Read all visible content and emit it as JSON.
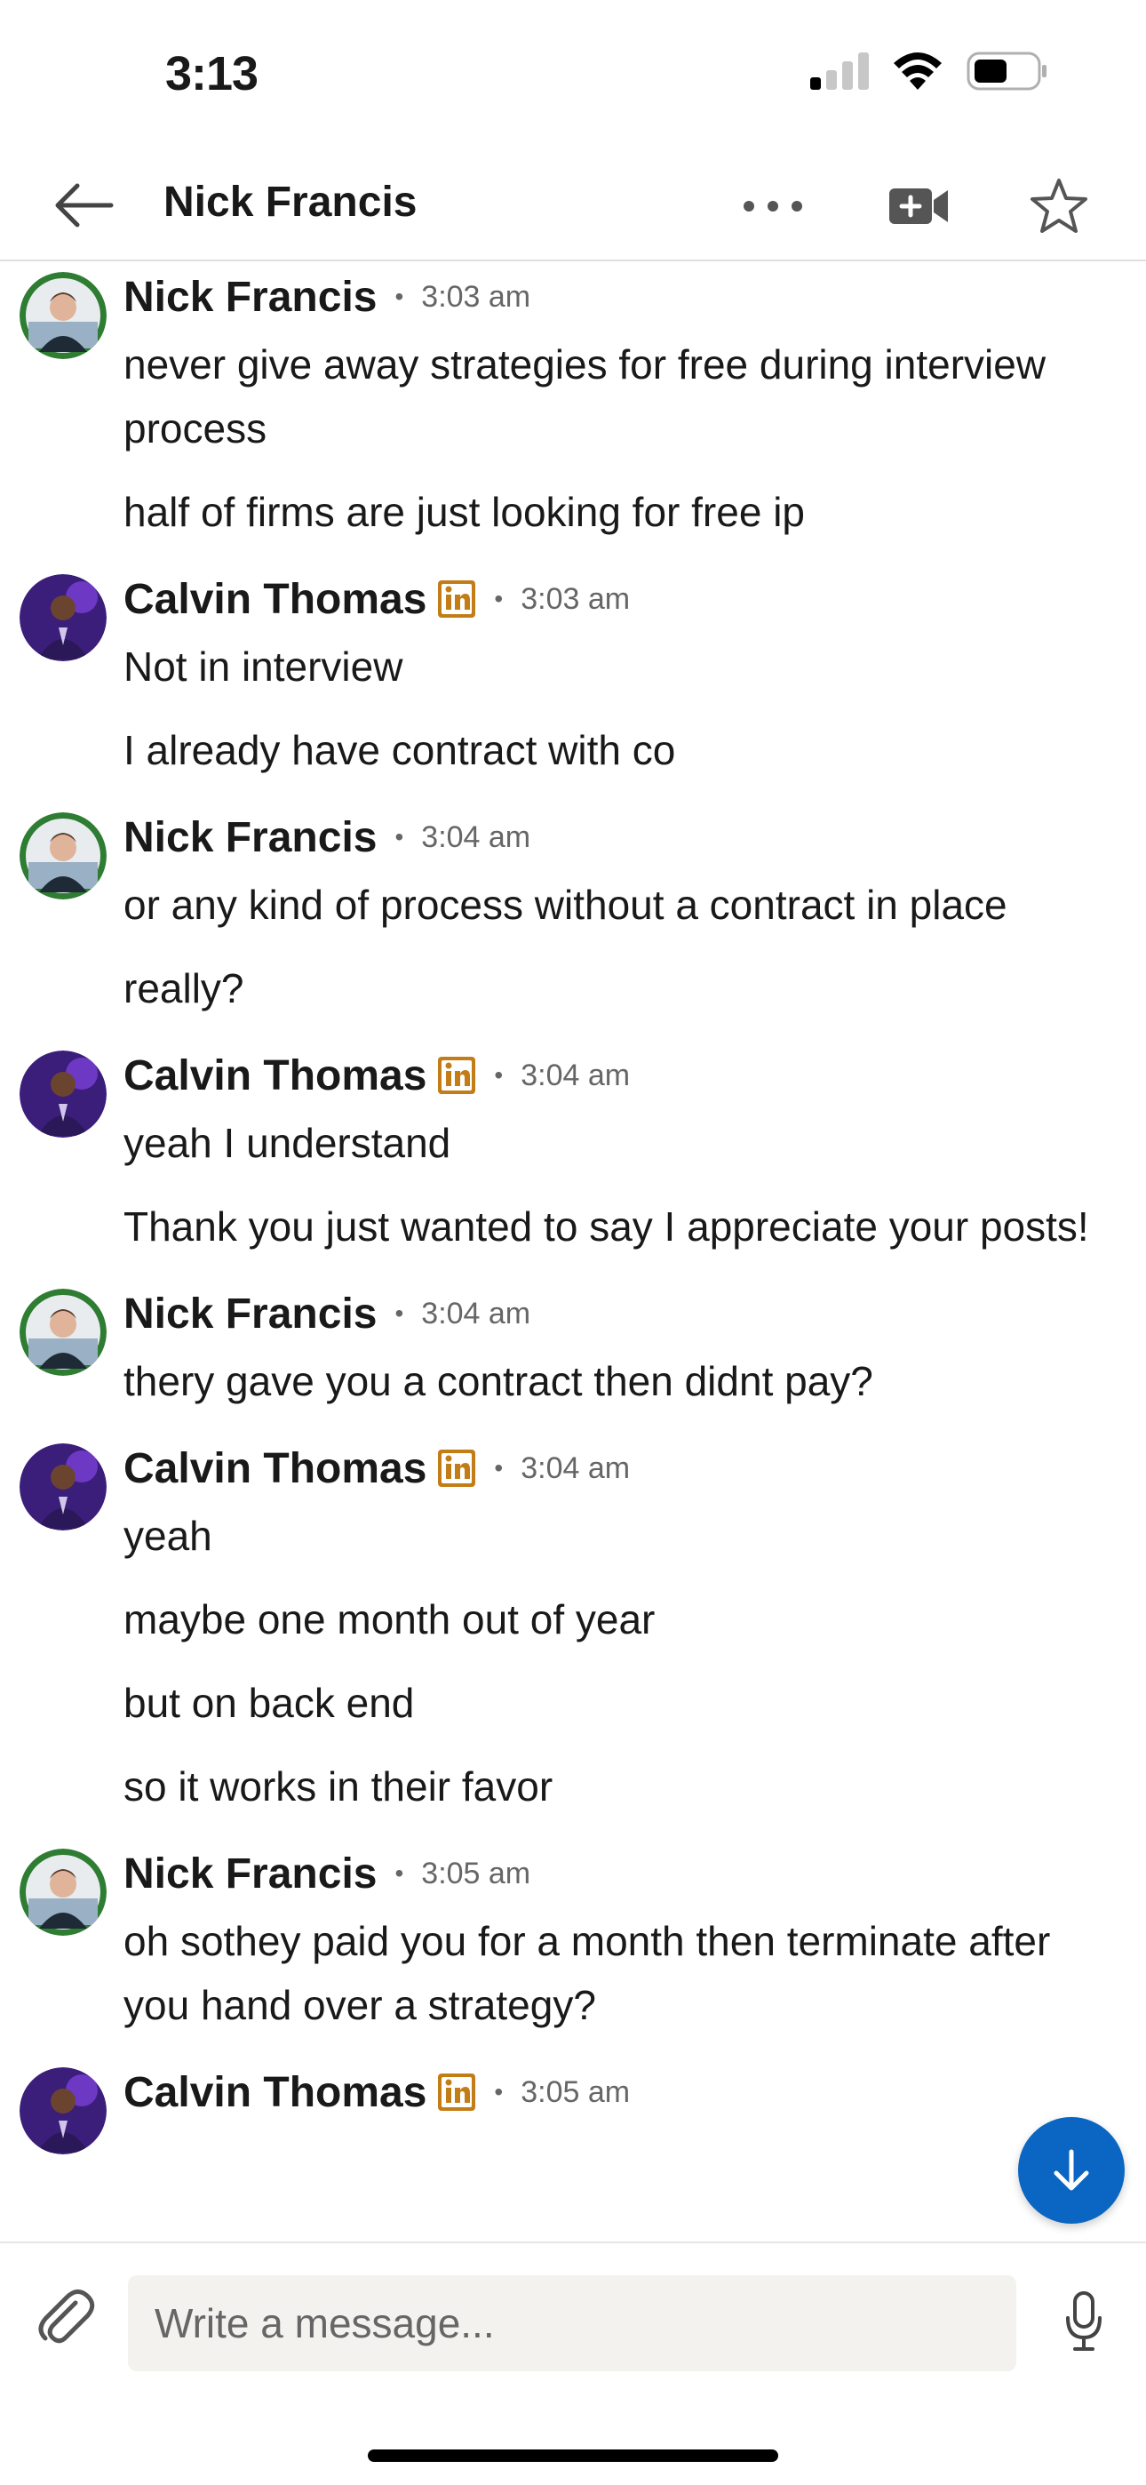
{
  "status_bar": {
    "time": "3:13"
  },
  "header": {
    "title": "Nick Francis"
  },
  "colors": {
    "accent": "#0a66c2",
    "linkedin_badge": "#c37d16"
  },
  "messages": [
    {
      "sender": "Nick Francis",
      "time": "3:03 am",
      "linkedin": false,
      "texts": [
        "never give away strategies for free during interview process",
        "half of firms are just looking for free ip"
      ]
    },
    {
      "sender": "Calvin Thomas",
      "time": "3:03 am",
      "linkedin": true,
      "texts": [
        "Not in interview",
        "I already have contract with co"
      ]
    },
    {
      "sender": "Nick Francis",
      "time": "3:04 am",
      "linkedin": false,
      "texts": [
        "or any kind of process without a contract in place",
        "really?"
      ]
    },
    {
      "sender": "Calvin Thomas",
      "time": "3:04 am",
      "linkedin": true,
      "texts": [
        "yeah I understand",
        "Thank you just wanted to say I appreciate your posts!"
      ]
    },
    {
      "sender": "Nick Francis",
      "time": "3:04 am",
      "linkedin": false,
      "texts": [
        "thery gave you a contract then didnt pay?"
      ]
    },
    {
      "sender": "Calvin Thomas",
      "time": "3:04 am",
      "linkedin": true,
      "texts": [
        "yeah",
        "maybe one month out of year",
        "but on back end",
        "so it works in their favor"
      ]
    },
    {
      "sender": "Nick Francis",
      "time": "3:05 am",
      "linkedin": false,
      "texts": [
        "oh sothey paid you for a month then terminate after you hand over a strategy?"
      ]
    },
    {
      "sender": "Calvin Thomas",
      "time": "3:05 am",
      "linkedin": true,
      "texts": []
    }
  ],
  "composer": {
    "placeholder": "Write a message..."
  }
}
